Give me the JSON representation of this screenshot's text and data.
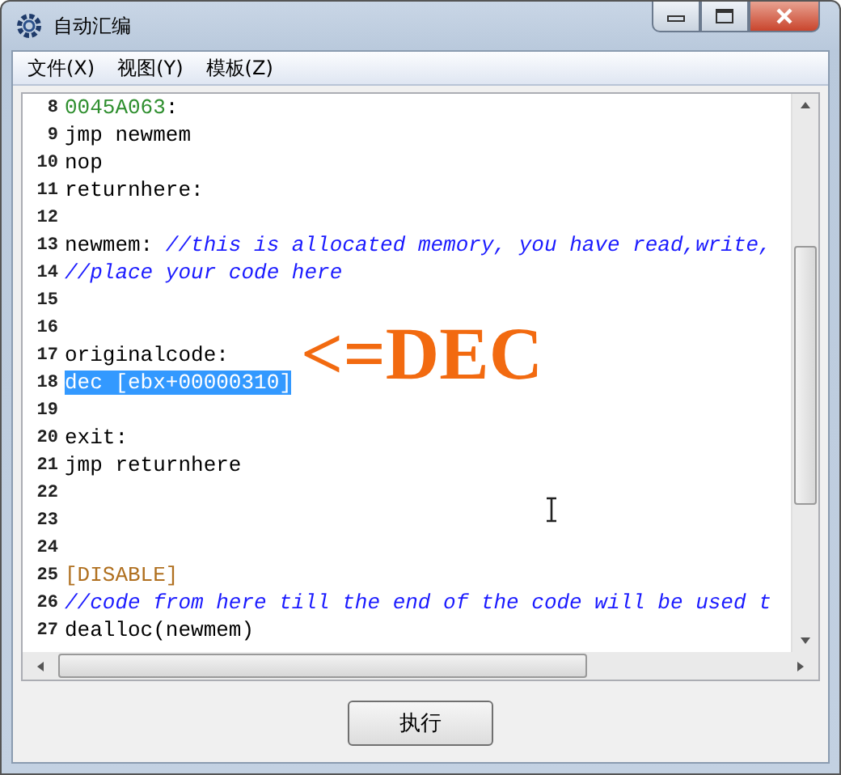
{
  "window": {
    "title": "自动汇编"
  },
  "menu": [
    {
      "label": "文件(X)"
    },
    {
      "label": "视图(Y)"
    },
    {
      "label": "模板(Z)"
    }
  ],
  "editor": {
    "lines": [
      {
        "number": "8",
        "selected": false,
        "segments": [
          {
            "text": "0045A063",
            "kind": "address"
          },
          {
            "text": ":",
            "kind": "plain"
          }
        ]
      },
      {
        "number": "9",
        "selected": false,
        "segments": [
          {
            "text": "jmp newmem",
            "kind": "plain"
          }
        ]
      },
      {
        "number": "10",
        "selected": false,
        "segments": [
          {
            "text": "nop",
            "kind": "plain"
          }
        ]
      },
      {
        "number": "11",
        "selected": false,
        "segments": [
          {
            "text": "returnhere:",
            "kind": "plain"
          }
        ]
      },
      {
        "number": "12",
        "selected": false
      },
      {
        "number": "13",
        "selected": false,
        "segments": [
          {
            "text": "newmem: ",
            "kind": "plain"
          },
          {
            "text": "//this is allocated memory, you have read,write,",
            "kind": "comment"
          }
        ]
      },
      {
        "number": "14",
        "selected": false,
        "segments": [
          {
            "text": "//place your code here",
            "kind": "comment"
          }
        ]
      },
      {
        "number": "15",
        "selected": false
      },
      {
        "number": "16",
        "selected": false
      },
      {
        "number": "17",
        "selected": false,
        "segments": [
          {
            "text": "originalcode:",
            "kind": "plain"
          }
        ]
      },
      {
        "number": "18",
        "selected": true,
        "segments": [
          {
            "text": "dec [ebx+00000310]",
            "kind": "plain"
          }
        ]
      },
      {
        "number": "19",
        "selected": false
      },
      {
        "number": "20",
        "selected": false,
        "segments": [
          {
            "text": "exit:",
            "kind": "plain"
          }
        ]
      },
      {
        "number": "21",
        "selected": false,
        "segments": [
          {
            "text": "jmp returnhere",
            "kind": "plain"
          }
        ]
      },
      {
        "number": "22",
        "selected": false
      },
      {
        "number": "23",
        "selected": false
      },
      {
        "number": "24",
        "selected": false
      },
      {
        "number": "25",
        "selected": false,
        "segments": [
          {
            "text": "[DISABLE]",
            "kind": "section"
          }
        ]
      },
      {
        "number": "26",
        "selected": false,
        "segments": [
          {
            "text": "//code from here till the end of the code will be used t",
            "kind": "comment"
          }
        ]
      },
      {
        "number": "27",
        "selected": false,
        "segments": [
          {
            "text": "dealloc(newmem)",
            "kind": "plain"
          }
        ]
      }
    ]
  },
  "annotation": {
    "text": "<=DEC"
  },
  "buttons": [
    {
      "label": "执行"
    }
  ]
}
